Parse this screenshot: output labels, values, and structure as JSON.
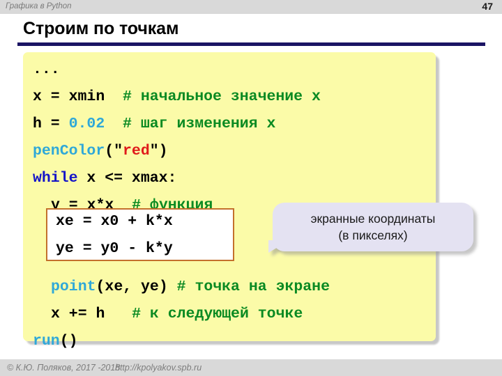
{
  "header": {
    "title": "Графика в Python",
    "slide_number": "47"
  },
  "slide": {
    "title": "Строим по точкам"
  },
  "code": {
    "lines": [
      {
        "id": "l1",
        "indent": 0,
        "tokens": [
          {
            "t": "...",
            "c": "plain"
          }
        ]
      },
      {
        "id": "l2",
        "indent": 0,
        "tokens": [
          {
            "t": "x = xmin  ",
            "c": "plain"
          },
          {
            "t": "# начальное значение x",
            "c": "comment"
          }
        ]
      },
      {
        "id": "l3",
        "indent": 0,
        "tokens": [
          {
            "t": "h = ",
            "c": "plain"
          },
          {
            "t": "0.02",
            "c": "number"
          },
          {
            "t": "  ",
            "c": "plain"
          },
          {
            "t": "# шаг изменения x",
            "c": "comment"
          }
        ]
      },
      {
        "id": "l4",
        "indent": 0,
        "tokens": [
          {
            "t": "penColor",
            "c": "function"
          },
          {
            "t": "(\"",
            "c": "plain"
          },
          {
            "t": "red",
            "c": "string"
          },
          {
            "t": "\")",
            "c": "plain"
          }
        ]
      },
      {
        "id": "l5",
        "indent": 0,
        "tokens": [
          {
            "t": "while",
            "c": "keyword"
          },
          {
            "t": " x <= xmax:",
            "c": "plain"
          }
        ]
      },
      {
        "id": "l6",
        "indent": 1,
        "tokens": [
          {
            "t": "y = x*x  ",
            "c": "plain"
          },
          {
            "t": "# функция",
            "c": "comment"
          }
        ]
      },
      {
        "id": "l7",
        "indent": 1,
        "tokens": [
          {
            "t": "",
            "c": "plain"
          }
        ]
      },
      {
        "id": "l8",
        "indent": 1,
        "tokens": [
          {
            "t": "",
            "c": "plain"
          }
        ]
      },
      {
        "id": "l9",
        "indent": 1,
        "tokens": [
          {
            "t": "point",
            "c": "function"
          },
          {
            "t": "(xe, ye) ",
            "c": "plain"
          },
          {
            "t": "# точка на экране",
            "c": "comment"
          }
        ]
      },
      {
        "id": "l10",
        "indent": 1,
        "tokens": [
          {
            "t": "x += h   ",
            "c": "plain"
          },
          {
            "t": "# к следующей точке",
            "c": "comment"
          }
        ]
      },
      {
        "id": "l11",
        "indent": 0,
        "tokens": [
          {
            "t": "run",
            "c": "function"
          },
          {
            "t": "()",
            "c": "plain"
          }
        ]
      }
    ]
  },
  "highlight_box": {
    "line_1": "xe = x0 + k*x",
    "line_2": "ye = y0 - k*y",
    "border_color": "#c3702c"
  },
  "callout": {
    "line_1": "экранные координаты",
    "line_2": "(в пикселях)",
    "fill_color": "#e4e2f2"
  },
  "footer": {
    "copyright": "© К.Ю. Поляков, 2017 -2018",
    "url": "http://kpolyakov.spb.ru"
  },
  "colors": {
    "code_background": "#fbfba8",
    "rule": "#1b1464",
    "comment": "#0a8a22",
    "keyword": "#1414c8",
    "function": "#2fa8d8",
    "string": "#e01b1b",
    "number": "#2fa8d8",
    "header_bar": "#d9d9d9"
  }
}
